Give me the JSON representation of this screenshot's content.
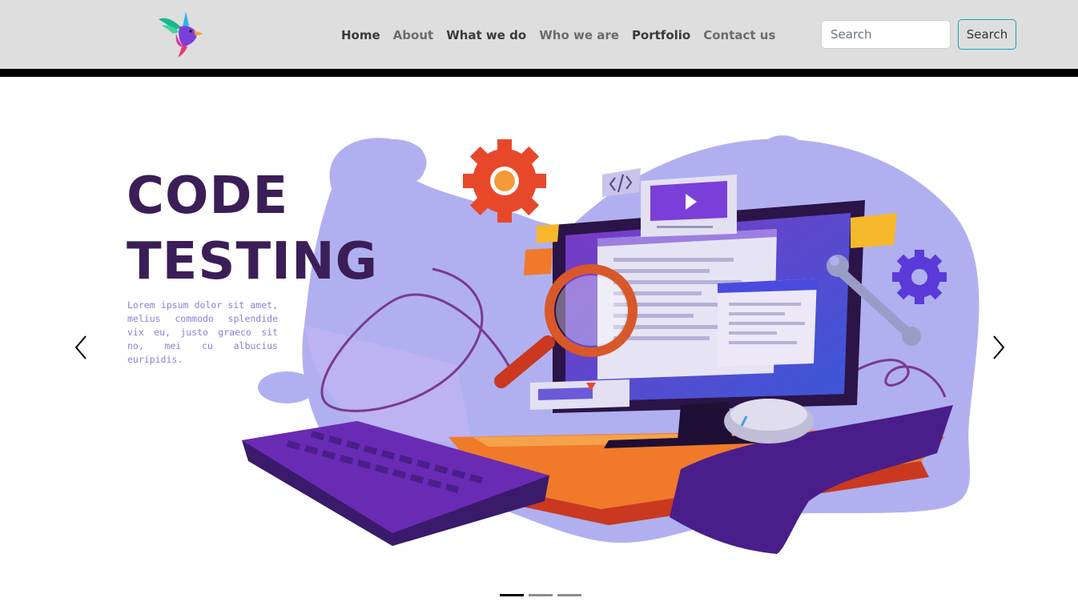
{
  "navbar": {
    "logo_name": "hummingbird-logo",
    "links": [
      {
        "label": "Home",
        "style": "dark"
      },
      {
        "label": "About",
        "style": "muted"
      },
      {
        "label": "What we do",
        "style": "dark"
      },
      {
        "label": "Who we are",
        "style": "muted"
      },
      {
        "label": "Portfolio",
        "style": "dark"
      },
      {
        "label": "Contact us",
        "style": "muted"
      }
    ],
    "search": {
      "placeholder": "Search",
      "button_label": "Search"
    }
  },
  "hero": {
    "title_line1": "CODE",
    "title_line2": "TESTING",
    "body": "Lorem ipsum dolor sit amet, melius commodo splendide vix eu, justo graeco sit no, mei cu albucius euripidis.",
    "illustration_icons": [
      "monitor-icon",
      "keyboard-icon",
      "mouse-icon",
      "magnifier-icon",
      "gear-icon",
      "wrench-icon",
      "code-tag-icon",
      "play-icon"
    ]
  },
  "carousel": {
    "prev_icon": "chevron-left-icon",
    "next_icon": "chevron-right-icon",
    "slides": 3,
    "active_index": 0
  },
  "colors": {
    "navbar_bg": "#dedede",
    "title": "#3b1e57",
    "accent_purple": "#6a2bb4",
    "blob": "#b0b0f0",
    "search_button_border": "#17a2b8"
  }
}
